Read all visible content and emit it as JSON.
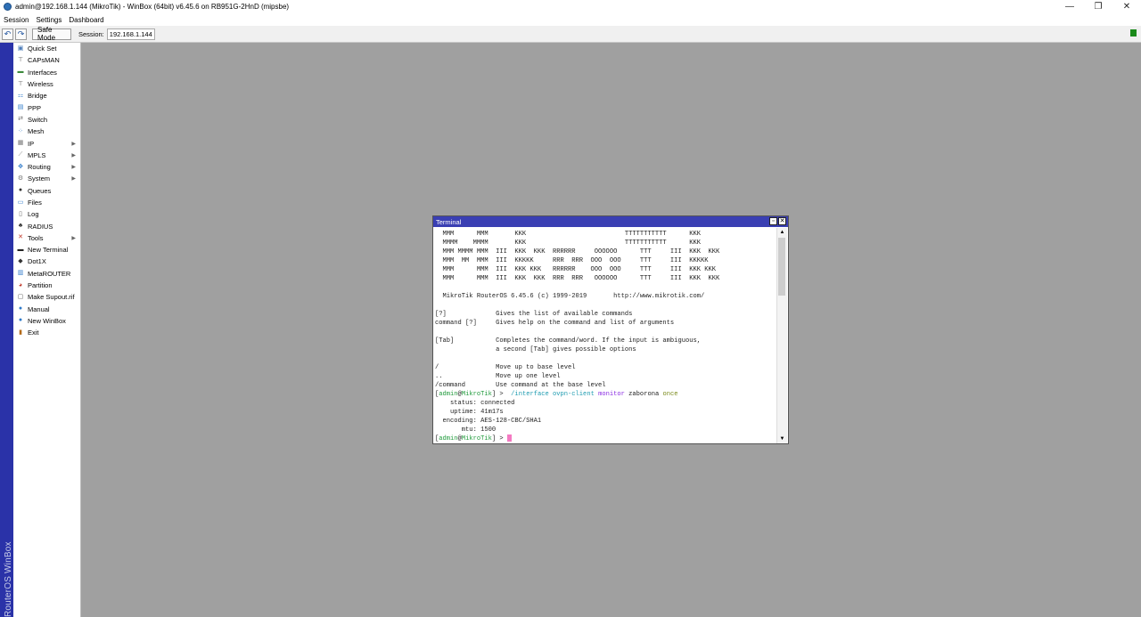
{
  "window": {
    "title": "admin@192.168.1.144 (MikroTik) - WinBox (64bit) v6.45.6 on RB951G-2HnD (mipsbe)",
    "controls": {
      "minimize": "—",
      "restore": "❐",
      "close": "✕"
    }
  },
  "menubar": {
    "items": [
      "Session",
      "Settings",
      "Dashboard"
    ]
  },
  "toolbar": {
    "undo_icon": "undo-icon",
    "redo_icon": "redo-icon",
    "safe_mode_label": "Safe Mode",
    "session_label": "Session:",
    "session_value": "192.168.1.144",
    "status_color": "#1b8a1b"
  },
  "brand": {
    "text": "RouterOS WinBox",
    "color": "#2a32a8"
  },
  "sidebar": {
    "items": [
      {
        "label": "Quick Set",
        "icon": "quick-set-icon",
        "glyph": "▣",
        "color": "#4a7ab8",
        "submenu": false
      },
      {
        "label": "CAPsMAN",
        "icon": "antenna-icon",
        "glyph": "⊤",
        "color": "#555",
        "submenu": false
      },
      {
        "label": "Interfaces",
        "icon": "interfaces-icon",
        "glyph": "▬",
        "color": "#3c8a3c",
        "submenu": false
      },
      {
        "label": "Wireless",
        "icon": "wireless-icon",
        "glyph": "⊤",
        "color": "#555",
        "submenu": false
      },
      {
        "label": "Bridge",
        "icon": "bridge-icon",
        "glyph": "⚏",
        "color": "#2f7ac9",
        "submenu": false
      },
      {
        "label": "PPP",
        "icon": "ppp-icon",
        "glyph": "▤",
        "color": "#2f7ac9",
        "submenu": false
      },
      {
        "label": "Switch",
        "icon": "switch-icon",
        "glyph": "⇄",
        "color": "#666",
        "submenu": false
      },
      {
        "label": "Mesh",
        "icon": "mesh-icon",
        "glyph": "⁘",
        "color": "#2f7ac9",
        "submenu": false
      },
      {
        "label": "IP",
        "icon": "ip-icon",
        "glyph": "▦",
        "color": "#777",
        "submenu": true
      },
      {
        "label": "MPLS",
        "icon": "mpls-icon",
        "glyph": "⟋",
        "color": "#777",
        "submenu": true
      },
      {
        "label": "Routing",
        "icon": "routing-icon",
        "glyph": "✥",
        "color": "#2f7ac9",
        "submenu": true
      },
      {
        "label": "System",
        "icon": "gear-icon",
        "glyph": "⚙",
        "color": "#777",
        "submenu": true
      },
      {
        "label": "Queues",
        "icon": "queues-icon",
        "glyph": "●",
        "color": "#333",
        "submenu": false
      },
      {
        "label": "Files",
        "icon": "folder-icon",
        "glyph": "▭",
        "color": "#2f7ac9",
        "submenu": false
      },
      {
        "label": "Log",
        "icon": "log-icon",
        "glyph": "▯",
        "color": "#666",
        "submenu": false
      },
      {
        "label": "RADIUS",
        "icon": "radius-icon",
        "glyph": "♣",
        "color": "#333",
        "submenu": false
      },
      {
        "label": "Tools",
        "icon": "tools-icon",
        "glyph": "✕",
        "color": "#c0392b",
        "submenu": true
      },
      {
        "label": "New Terminal",
        "icon": "terminal-icon",
        "glyph": "▬",
        "color": "#222",
        "submenu": false
      },
      {
        "label": "Dot1X",
        "icon": "dot1x-icon",
        "glyph": "◆",
        "color": "#333",
        "submenu": false
      },
      {
        "label": "MetaROUTER",
        "icon": "metarouter-icon",
        "glyph": "▥",
        "color": "#2f7ac9",
        "submenu": false
      },
      {
        "label": "Partition",
        "icon": "partition-icon",
        "glyph": "◕",
        "color": "#c0392b",
        "submenu": false
      },
      {
        "label": "Make Supout.rif",
        "icon": "supout-icon",
        "glyph": "▢",
        "color": "#555",
        "submenu": false
      },
      {
        "label": "Manual",
        "icon": "manual-icon",
        "glyph": "●",
        "color": "#2f7ac9",
        "submenu": false
      },
      {
        "label": "New WinBox",
        "icon": "winbox-icon",
        "glyph": "●",
        "color": "#2f7ac9",
        "submenu": false
      },
      {
        "label": "Exit",
        "icon": "exit-icon",
        "glyph": "▮",
        "color": "#b36b1a",
        "submenu": false
      }
    ]
  },
  "terminal": {
    "title": "Terminal",
    "restore_glyph": "▫",
    "close_glyph": "✕",
    "scroll_up": "▲",
    "scroll_down": "▼",
    "lines": [
      [
        {
          "t": "  MMM      MMM       KKK                          TTTTTTTTTTT      KKK"
        }
      ],
      [
        {
          "t": "  MMMM    MMMM       KKK                          TTTTTTTTTTT      KKK"
        }
      ],
      [
        {
          "t": "  MMM MMMM MMM  III  KKK  KKK  RRRRRR     OOOOOO      TTT     III  KKK  KKK"
        }
      ],
      [
        {
          "t": "  MMM  MM  MMM  III  KKKKK     RRR  RRR  OOO  OOO     TTT     III  KKKKK"
        }
      ],
      [
        {
          "t": "  MMM      MMM  III  KKK KKK   RRRRRR    OOO  OOO     TTT     III  KKK KKK"
        }
      ],
      [
        {
          "t": "  MMM      MMM  III  KKK  KKK  RRR  RRR   OOOOOO      TTT     III  KKK  KKK"
        }
      ],
      [
        {
          "t": ""
        }
      ],
      [
        {
          "t": "  MikroTik RouterOS 6.45.6 (c) 1999-2019       http://www.mikrotik.com/"
        }
      ],
      [
        {
          "t": ""
        }
      ],
      [
        {
          "t": "[?]             Gives the list of available commands"
        }
      ],
      [
        {
          "t": "command [?]     Gives help on the command and list of arguments"
        }
      ],
      [
        {
          "t": ""
        }
      ],
      [
        {
          "t": "[Tab]           Completes the command/word. If the input is ambiguous,"
        }
      ],
      [
        {
          "t": "                a second [Tab] gives possible options"
        }
      ],
      [
        {
          "t": ""
        }
      ],
      [
        {
          "t": "/               Move up to base level"
        }
      ],
      [
        {
          "t": "..              Move up one level"
        }
      ],
      [
        {
          "t": "/command        Use command at the base level"
        }
      ],
      [
        {
          "t": "["
        },
        {
          "t": "admin",
          "c": "green"
        },
        {
          "t": "@"
        },
        {
          "t": "MikroTik",
          "c": "green"
        },
        {
          "t": "] > "
        },
        {
          "t": " /interface ovpn-client ",
          "c": "cyan"
        },
        {
          "t": "monitor",
          "c": "purple"
        },
        {
          "t": " zaborona "
        },
        {
          "t": "once",
          "c": "olive"
        }
      ],
      [
        {
          "t": "    status: connected"
        }
      ],
      [
        {
          "t": "    uptime: 41m17s"
        }
      ],
      [
        {
          "t": "  encoding: AES-128-CBC/SHA1"
        }
      ],
      [
        {
          "t": "       mtu: 1500"
        }
      ],
      [
        {
          "t": "["
        },
        {
          "t": "admin",
          "c": "green"
        },
        {
          "t": "@"
        },
        {
          "t": "MikroTik",
          "c": "green"
        },
        {
          "t": "] > "
        },
        {
          "cursor": true
        }
      ]
    ]
  }
}
